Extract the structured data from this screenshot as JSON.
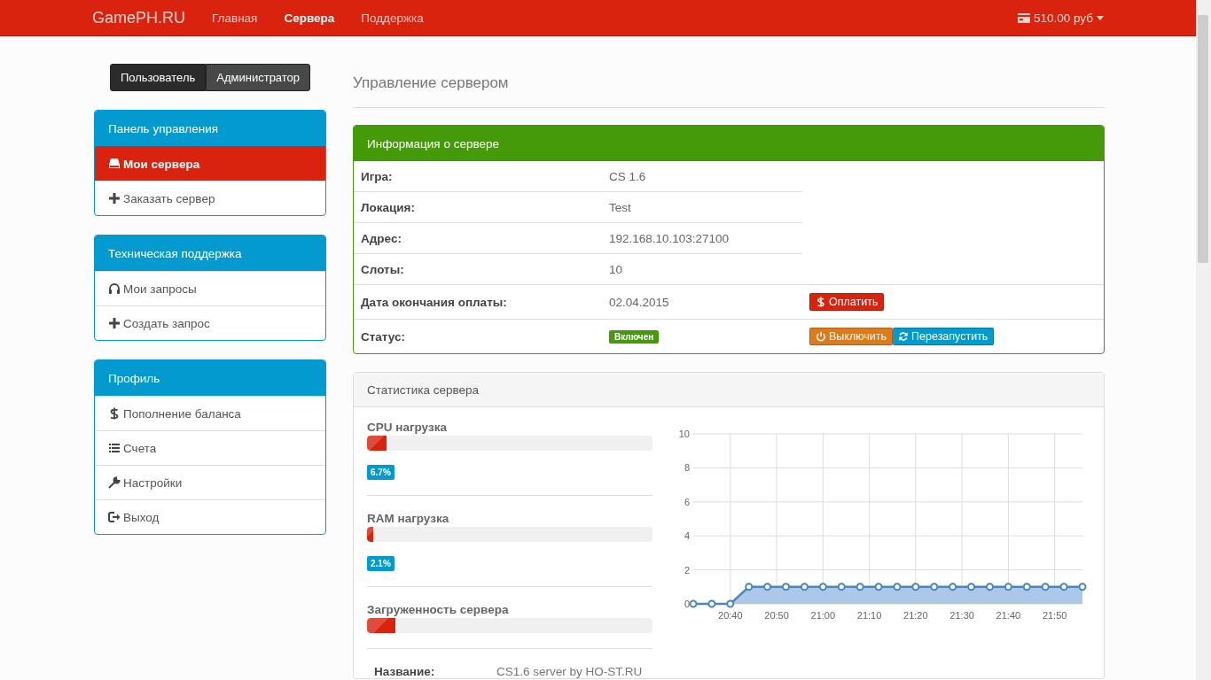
{
  "navbar": {
    "brand": "GamePH.RU",
    "links": [
      {
        "label": "Главная",
        "selected": false
      },
      {
        "label": "Сервера",
        "selected": true
      },
      {
        "label": "Поддержка",
        "selected": false
      }
    ],
    "balance": "510.00 руб"
  },
  "role_toggle": [
    {
      "label": "Пользователь",
      "selected": true
    },
    {
      "label": "Администратор",
      "selected": false
    }
  ],
  "sidebar": [
    {
      "title": "Панель управления",
      "items": [
        {
          "label": "Мои сервера",
          "selected": true
        },
        {
          "label": "Заказать сервер",
          "selected": false
        }
      ]
    },
    {
      "title": "Техническая поддержка",
      "items": [
        {
          "label": "Мои запросы",
          "selected": false
        },
        {
          "label": "Создать запрос",
          "selected": false
        }
      ]
    },
    {
      "title": "Профиль",
      "items": [
        {
          "label": "Пополнение баланса",
          "selected": false
        },
        {
          "label": "Счета",
          "selected": false
        },
        {
          "label": "Настройки",
          "selected": false
        },
        {
          "label": "Выход",
          "selected": false
        }
      ]
    }
  ],
  "page_title": "Управление сервером",
  "server_info": {
    "title": "Информация о сервере",
    "rows": [
      {
        "label": "Игра:",
        "value": "CS 1.6",
        "kind": "text"
      },
      {
        "label": "Локация:",
        "value": "Test",
        "kind": "text"
      },
      {
        "label": "Адрес:",
        "value": "192.168.10.103:27100",
        "kind": "text"
      },
      {
        "label": "Слоты:",
        "value": "10",
        "kind": "text"
      },
      {
        "label": "Дата окончания оплаты:",
        "value": "02.04.2015",
        "kind": "text",
        "actions": [
          {
            "label": "Оплатить",
            "kind": "pay"
          }
        ]
      },
      {
        "label": "Статус:",
        "value": "Включен",
        "kind": "badge",
        "actions": [
          {
            "label": "Выключить",
            "kind": "stop"
          },
          {
            "label": "Перезапустить",
            "kind": "restart"
          }
        ]
      }
    ]
  },
  "stats": {
    "title": "Статистика сервера",
    "meters": [
      {
        "label": "CPU нагрузка",
        "level": 0.067,
        "reading": "6.7%"
      },
      {
        "label": "RAM нагрузка",
        "level": 0.021,
        "reading": "2.1%"
      },
      {
        "label": "Загруженность сервера",
        "level": 0.1
      }
    ],
    "details": [
      {
        "label": "Название:",
        "value": "CS1.6 server by HO-ST.RU"
      }
    ],
    "chart_data": {
      "type": "area",
      "x": [
        1232,
        1236,
        1240,
        1244,
        1248,
        1252,
        1256,
        1260,
        1264,
        1268,
        1272,
        1276,
        1280,
        1284,
        1288,
        1292,
        1296,
        1300,
        1304,
        1308,
        1312,
        1316
      ],
      "series": [
        {
          "color": "#4a86bf",
          "values": [
            0,
            0,
            0,
            1,
            1,
            1,
            1,
            1,
            1,
            1,
            1,
            1,
            1,
            1,
            1,
            1,
            1,
            1,
            1,
            1,
            1,
            1
          ]
        }
      ],
      "xlim": [
        1232,
        1316
      ],
      "ylim": [
        0,
        10
      ],
      "xticks": [
        {
          "value": 1240,
          "label": "20:40"
        },
        {
          "value": 1250,
          "label": "20:50"
        },
        {
          "value": 1260,
          "label": "21:00"
        },
        {
          "value": 1270,
          "label": "21:10"
        },
        {
          "value": 1280,
          "label": "21:20"
        },
        {
          "value": 1290,
          "label": "21:30"
        },
        {
          "value": 1300,
          "label": "21:40"
        },
        {
          "value": 1310,
          "label": "21:50"
        }
      ],
      "yticks": [
        0,
        2,
        4,
        6,
        8,
        10
      ],
      "grid": true
    }
  }
}
